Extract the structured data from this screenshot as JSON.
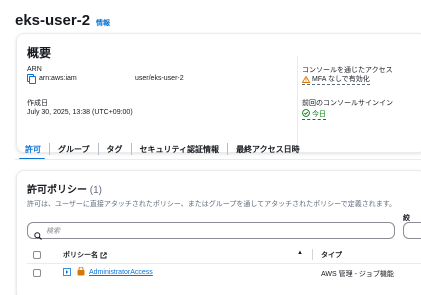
{
  "page": {
    "title": "eks-user-2",
    "info_link": "情報"
  },
  "summary": {
    "title": "概要",
    "arn_label": "ARN",
    "arn_prefix": "arn:aws:iam",
    "arn_suffix": "user/eks-user-2",
    "created_label": "作成日",
    "created_value": "July 30, 2025, 13:38 (UTC+09:00)",
    "console_access_label": "コンソールを通じたアクセス",
    "console_access_value": "MFA なしで有効化",
    "last_signin_label": "前回のコンソールサインイン",
    "last_signin_value": "今日"
  },
  "tabs": [
    {
      "label": "許可",
      "active": true
    },
    {
      "label": "グループ",
      "active": false
    },
    {
      "label": "タグ",
      "active": false
    },
    {
      "label": "セキュリティ認証情報",
      "active": false
    },
    {
      "label": "最終アクセス日時",
      "active": false
    }
  ],
  "policies": {
    "title": "許可ポリシー",
    "count": "(1)",
    "description": "許可は、ユーザーに直接アタッチされたポリシー、またはグループを通してアタッチされたポリシーで定義されます。",
    "filter_label": "絞",
    "search_placeholder": "検索",
    "columns": {
      "name": "ポリシー名",
      "sort": "▲",
      "type": "タイプ"
    },
    "rows": [
      {
        "name": "AdministratorAccess",
        "type": "AWS 管理 - ジョブ機能"
      }
    ]
  },
  "colors": {
    "link": "#0972d3",
    "success": "#037f0c",
    "warning": "#d97706",
    "text": "#16191f",
    "muted": "#5f6b7a"
  }
}
